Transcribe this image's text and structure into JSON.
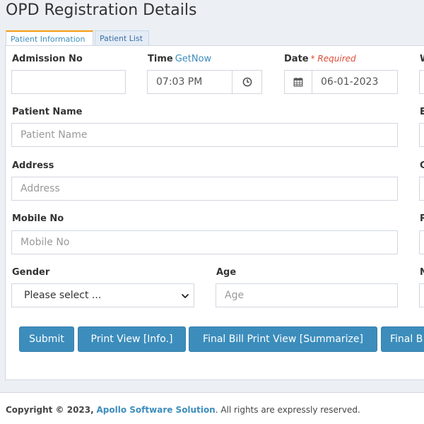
{
  "page": {
    "title": "OPD Registration Details"
  },
  "tabs": [
    {
      "label": "Patient Information",
      "active": true
    },
    {
      "label": "Patient List",
      "active": false
    }
  ],
  "form": {
    "admission_no": {
      "label": "Admission No",
      "value": ""
    },
    "time": {
      "label": "Time",
      "getnow": "GetNow",
      "value": "07:03 PM",
      "icon": "clock-icon"
    },
    "date": {
      "label": "Date",
      "required": "* Required",
      "value": "06-01-2023",
      "icon": "calendar-icon"
    },
    "patient_name": {
      "label": "Patient Name",
      "placeholder": "Patient Name"
    },
    "address": {
      "label": "Address",
      "placeholder": "Address"
    },
    "mobile_no": {
      "label": "Mobile No",
      "placeholder": "Mobile No"
    },
    "gender": {
      "label": "Gender",
      "selected": "Please select ..."
    },
    "age": {
      "label": "Age",
      "placeholder": "Age"
    },
    "right_column_labels": [
      "W",
      "E",
      "C",
      "R",
      "N"
    ]
  },
  "buttons": {
    "submit": "Submit",
    "print_info": "Print View [Info.]",
    "final_bill_summarize": "Final Bill Print View [Summarize]",
    "final_bill_cut": "Final B"
  },
  "footer": {
    "copyright": "Copyright © 2023,",
    "company": "Apollo Software Solution",
    "rest": ". All rights are expressly reserved."
  },
  "colors": {
    "accent": "#3c8dbc",
    "tab_active_border": "#f39c12",
    "required": "#dd4b39",
    "page_bg": "#ecf0f5"
  }
}
